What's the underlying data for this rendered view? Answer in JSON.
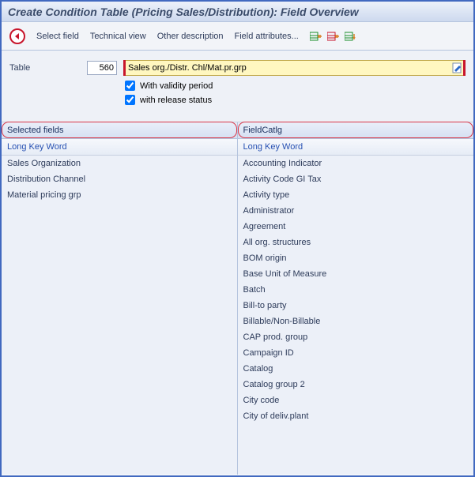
{
  "window_title": "Create Condition Table (Pricing Sales/Distribution): Field Overview",
  "toolbar": {
    "select_field": "Select field",
    "technical_view": "Technical view",
    "other_description": "Other description",
    "field_attributes": "Field attributes..."
  },
  "form": {
    "table_label": "Table",
    "table_number": "560",
    "table_name": "Sales org./Distr. Chl/Mat.pr.grp",
    "validity_label": "With validity period",
    "release_label": "with release status",
    "validity_checked": true,
    "release_checked": true
  },
  "selected": {
    "title": "Selected fields",
    "column_header": "Long Key Word",
    "items": [
      "Sales Organization",
      "Distribution Channel",
      "Material pricing grp"
    ]
  },
  "catalog": {
    "title": "FieldCatlg",
    "column_header": "Long Key Word",
    "items": [
      "Accounting Indicator",
      "Activity Code GI Tax",
      "Activity type",
      "Administrator",
      "Agreement",
      "All org. structures",
      "BOM origin",
      "Base Unit of Measure",
      "Batch",
      "Bill-to party",
      "Billable/Non-Billable",
      "CAP prod. group",
      "Campaign ID",
      "Catalog",
      "Catalog group 2",
      "City code",
      "City of deliv.plant"
    ]
  }
}
